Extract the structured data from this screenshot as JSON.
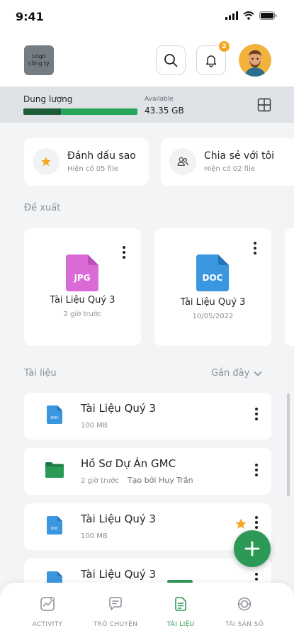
{
  "status_bar": {
    "time": "9:41"
  },
  "header": {
    "logo_text": "Logo công ty",
    "notification_count": "2",
    "icons": [
      "search-icon",
      "bell-icon",
      "avatar"
    ]
  },
  "storage": {
    "label": "Dung lượng",
    "available_label": "Available",
    "available_value": "43.35 GB",
    "used_fraction": 0.33
  },
  "quick_access": [
    {
      "title": "Đánh dấu sao",
      "subtitle": "Hiện có 05 file",
      "icon": "star-icon"
    },
    {
      "title": "Chia sẻ với tôi",
      "subtitle": "Hiện có 02 file",
      "icon": "users-icon"
    }
  ],
  "recommended": {
    "label": "Đề xuất",
    "items": [
      {
        "type": "JPG",
        "name": "Tài Liệu Quý 3",
        "meta": "2 giờ trước"
      },
      {
        "type": "DOC",
        "name": "Tài Liệu Quý 3",
        "meta": "10/05/2022"
      }
    ]
  },
  "documents": {
    "label": "Tài liệu",
    "sort_label": "Gần đây",
    "items": [
      {
        "name": "Tài Liệu Quý 3",
        "meta": "100 MB",
        "extra": "",
        "icon": "doc-file-icon",
        "starred": false
      },
      {
        "name": "Hồ Sơ Dự Án GMC",
        "meta": "2 giờ trước",
        "extra": "Tạo bởi Huy Trần",
        "icon": "folder-icon",
        "starred": false
      },
      {
        "name": "Tài Liệu Quý 3",
        "meta": "100 MB",
        "extra": "",
        "icon": "doc-file-icon",
        "starred": true
      },
      {
        "name": "Tài Liệu Quý 3",
        "meta": "",
        "extra": "",
        "icon": "doc-file-icon",
        "starred": false
      }
    ]
  },
  "tabs": [
    {
      "label": "ACTIVITY",
      "active": false
    },
    {
      "label": "TRÒ CHUYỆN",
      "active": false
    },
    {
      "label": "TÀI LIỆU",
      "active": true
    },
    {
      "label": "TÀI SẢN SỐ",
      "active": false
    }
  ],
  "colors": {
    "accent": "#2c9a56",
    "badge": "#f5a623",
    "jpg": "#d96ad6",
    "doc": "#3b96e0"
  }
}
